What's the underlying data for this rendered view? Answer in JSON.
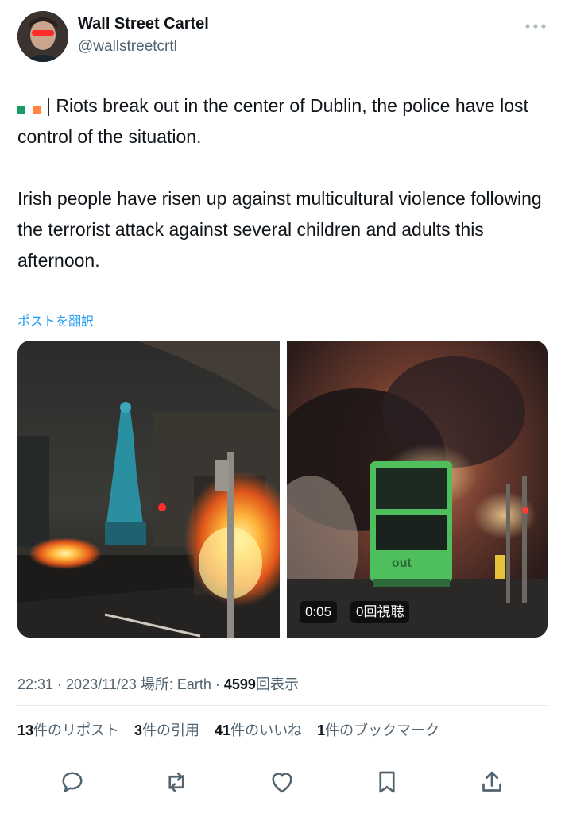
{
  "author": {
    "display_name": "Wall Street Cartel",
    "handle": "@wallstreetcrtl",
    "avatar_icon": "user-avatar"
  },
  "tweet": {
    "flag_icon": "ireland-flag-emoji",
    "paragraph1": "| Riots break out in the center of Dublin, the police have lost control of the situation.",
    "paragraph2": "Irish people have risen up against multicultural violence following the terrorist attack against several children and adults this afternoon.",
    "translate_link": "ポストを翻訳"
  },
  "media": {
    "video_duration": "0:05",
    "video_views": "0回視聴"
  },
  "meta": {
    "time": "22:31",
    "sep1": " · ",
    "date": "2023/11/23",
    "location": " 場所: Earth",
    "sep2": " · ",
    "views_count": "4599",
    "views_label": "回表示"
  },
  "stats": {
    "reposts_count": "13",
    "reposts_label": "件のリポスト",
    "quotes_count": "3",
    "quotes_label": "件の引用",
    "likes_count": "41",
    "likes_label": "件のいいね",
    "bookmarks_count": "1",
    "bookmarks_label": "件のブックマーク"
  },
  "colors": {
    "link": "#1d9bf0",
    "secondary_text": "#536471",
    "primary_text": "#0f1419",
    "bus_green": "#4fbf5e"
  }
}
